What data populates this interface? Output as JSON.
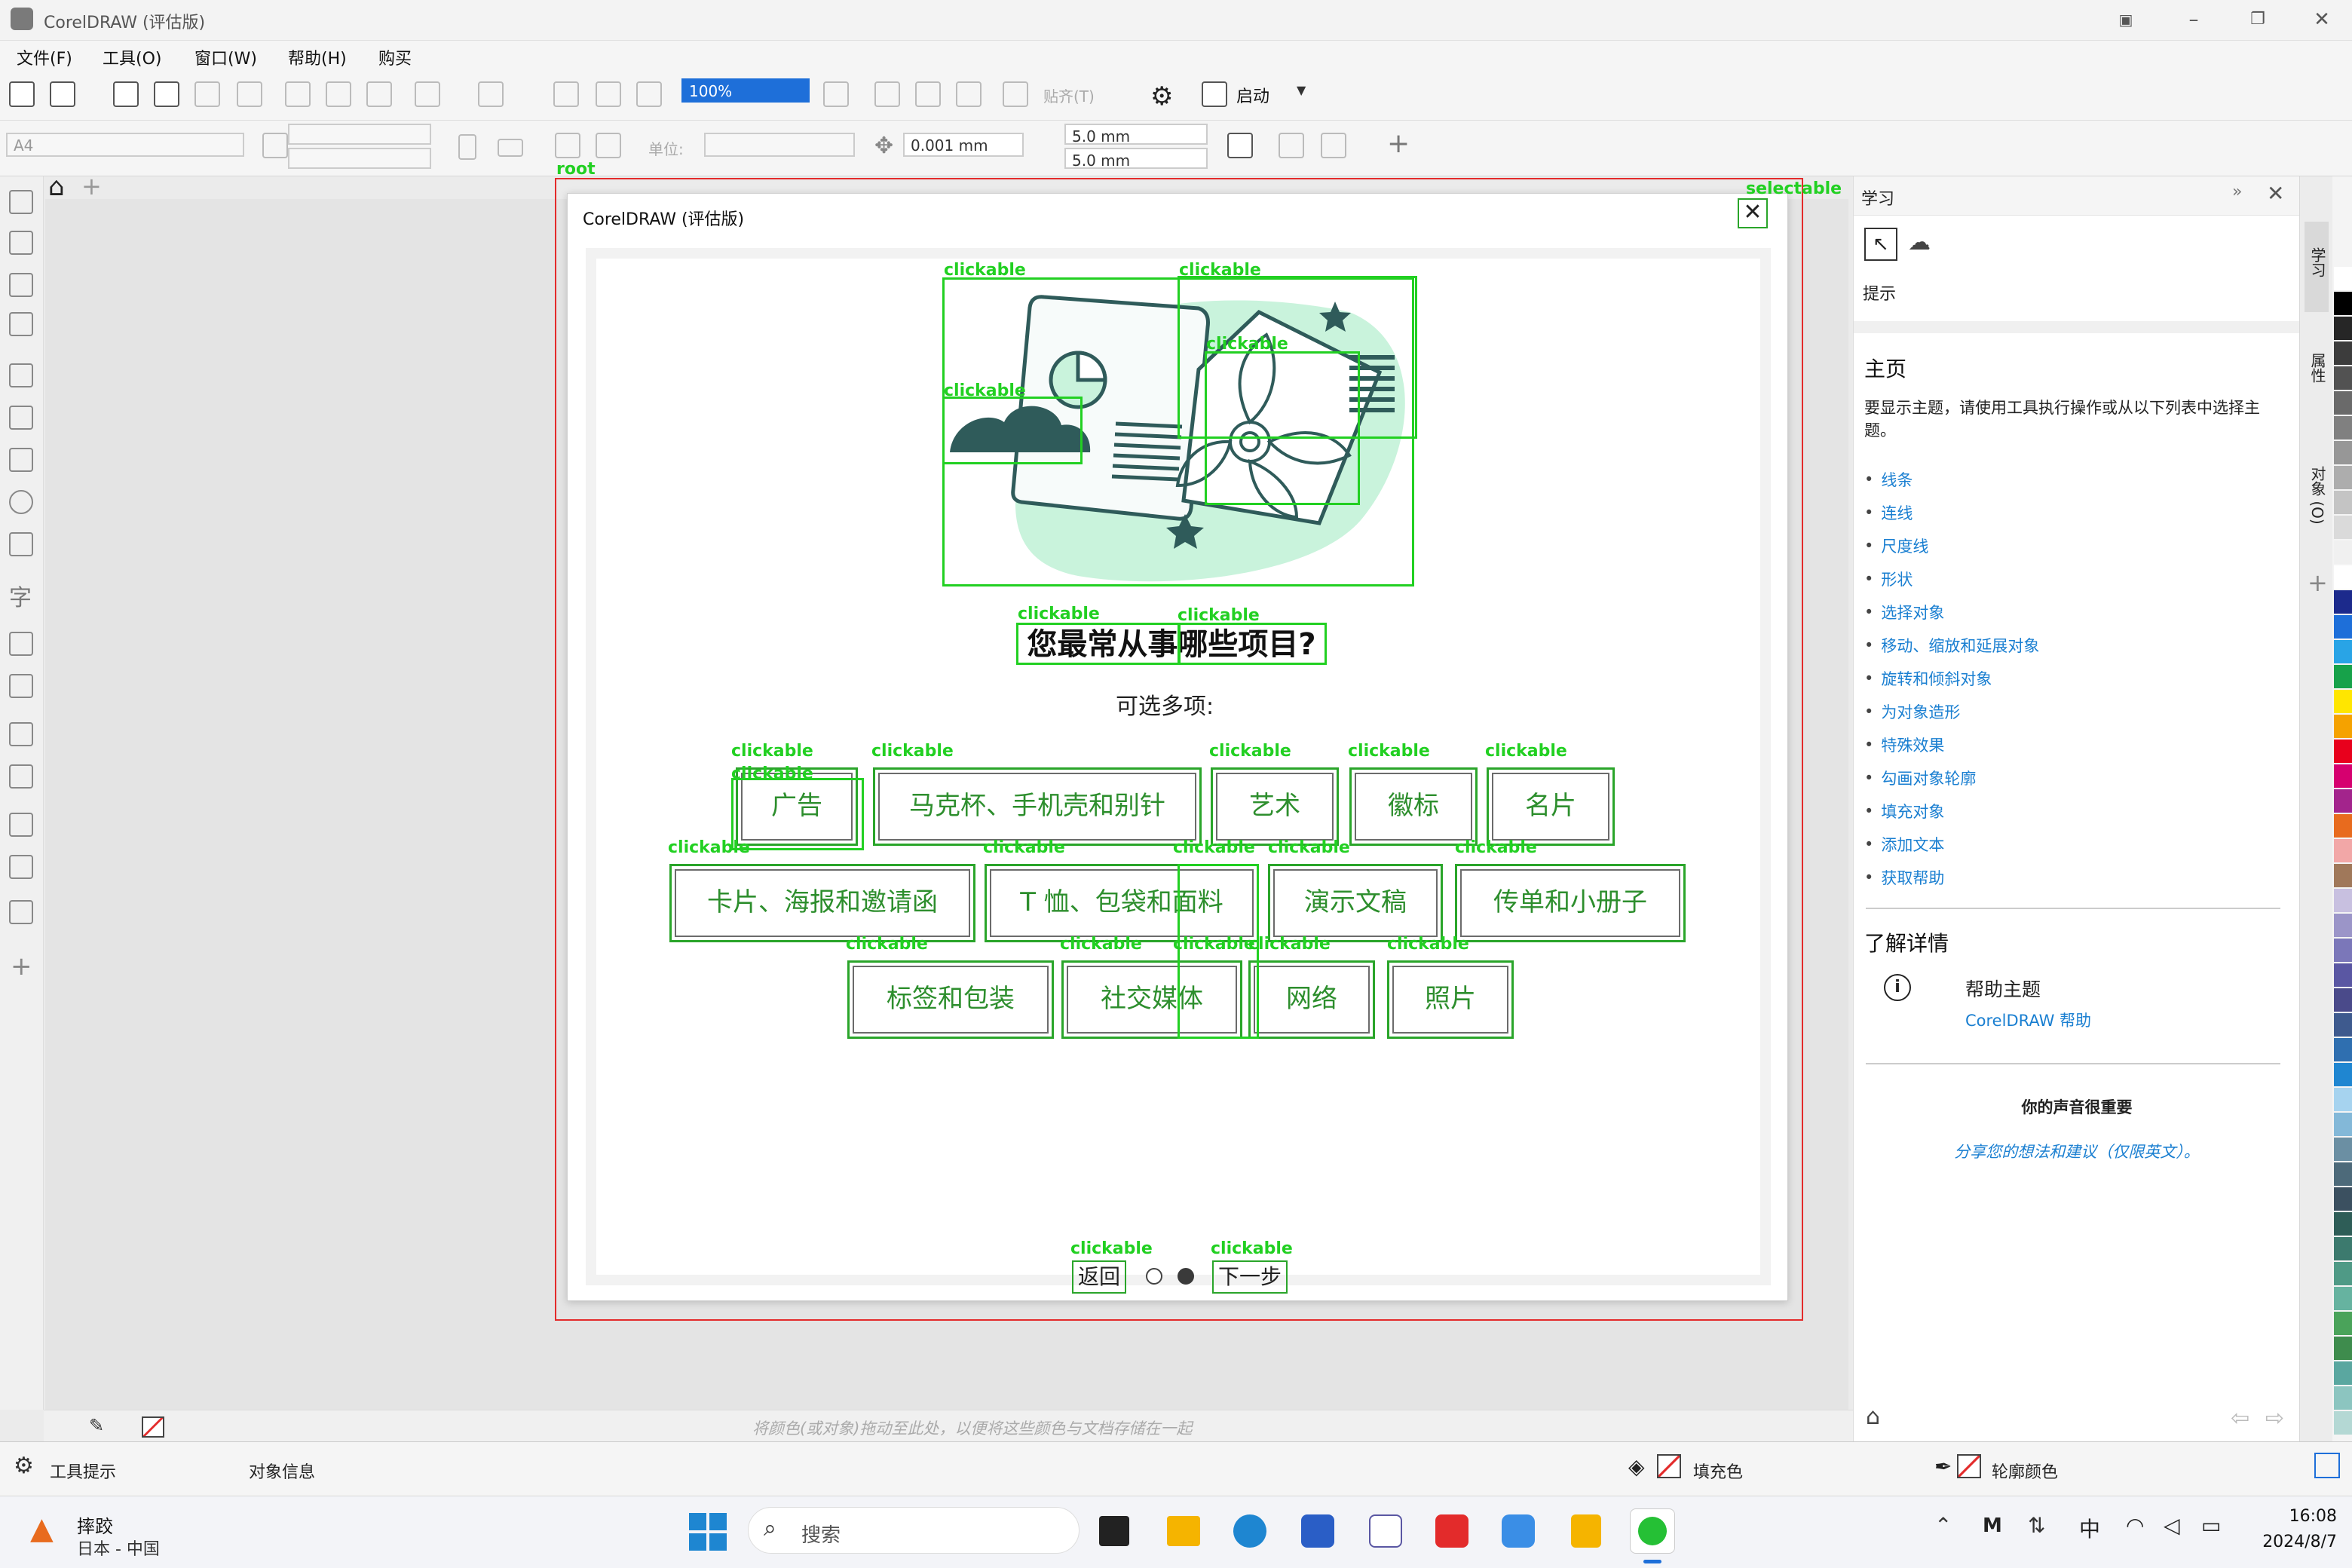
{
  "window": {
    "title": "CorelDRAW (评估版)"
  },
  "menu": [
    "文件(F)",
    "工具(O)",
    "窗口(W)",
    "帮助(H)",
    "购买"
  ],
  "toolbar": {
    "zoom_value": "100%",
    "snap_label": "贴齐(T)",
    "launch_label": "启动"
  },
  "propbar": {
    "page_size": "A4",
    "units_label": "单位:",
    "nudge": "0.001 mm",
    "dup_x": "5.0 mm",
    "dup_y": "5.0 mm"
  },
  "dialog": {
    "title": "CorelDRAW (评估版)",
    "close_glyph": "✕",
    "question": "您最常从事哪些项目?",
    "multi_hint": "可选多项:",
    "options_row1": [
      "广告",
      "马克杯、手机壳和别针",
      "艺术",
      "徽标",
      "名片"
    ],
    "options_row2": [
      "卡片、海报和邀请函",
      "T 恤、包袋和面料",
      "演示文稿",
      "传单和小册子"
    ],
    "options_row3": [
      "标签和包装",
      "社交媒体",
      "网络",
      "照片"
    ],
    "back_label": "返回",
    "next_label": "下一步",
    "page_indicator": {
      "total": 2,
      "current": 2
    }
  },
  "annotations": {
    "root_label": "root",
    "selectable_label": "selectable",
    "clickable_label": "clickable"
  },
  "learn_panel": {
    "header": "学习",
    "hints_label": "提示",
    "home_title": "主页",
    "home_desc": "要显示主题，请使用工具执行操作或从以下列表中选择主题。",
    "topics": [
      "线条",
      "连线",
      "尺度线",
      "形状",
      "选择对象",
      "移动、缩放和延展对象",
      "旋转和倾斜对象",
      "为对象造形",
      "特殊效果",
      "勾画对象轮廓",
      "填充对象",
      "添加文本",
      "获取帮助"
    ],
    "more_title": "了解详情",
    "help_title": "帮助主题",
    "help_link": "CorelDRAW 帮助",
    "voice_title": "你的声音很重要",
    "voice_link": "分享您的想法和建议（仅限英文）。"
  },
  "dock_tabs": [
    "学习",
    "属性",
    "对象 (O)"
  ],
  "palette_hint": "将颜色(或对象)拖动至此处，以便将这些颜色与文档存储在一起",
  "status": {
    "tool_hint": "工具提示",
    "object_info": "对象信息",
    "fill_label": "填充色",
    "outline_label": "轮廓颜色"
  },
  "taskbar": {
    "weather_title": "摔跤",
    "weather_sub": "日本 - 中国",
    "search_placeholder": "搜索",
    "ime": "中",
    "time": "16:08",
    "date": "2024/8/7"
  },
  "colors": {
    "accent_green": "#2d8e2d",
    "annotation_green": "#22d022",
    "annotation_red": "#e32b2b",
    "link_blue": "#1a7fd1",
    "illustration_teal": "#2f5b5a",
    "illustration_mint": "#c9f3dc"
  },
  "swatch_colors": [
    "#ffffff",
    "#000000",
    "#262626",
    "#3c3c3c",
    "#525252",
    "#6a6a6a",
    "#808080",
    "#979797",
    "#adadad",
    "#c4c4c4",
    "#dadada",
    "#f0f0f0",
    "#ffffff",
    "#1c2a8c",
    "#1e6fd9",
    "#29a4e6",
    "#17a24a",
    "#ffe600",
    "#f5a200",
    "#e8001c",
    "#d6006f",
    "#a3248c",
    "#e86b1e",
    "#f2a7a7",
    "#a0785a",
    "#c8c0e0",
    "#9b95c8",
    "#7b77b9",
    "#5a57a3",
    "#4a4a8a",
    "#3e5a8e",
    "#2f6fb0",
    "#1f86d1",
    "#a6d3ef",
    "#83b8d8",
    "#6b8fa3",
    "#4d6a7a",
    "#3b5060",
    "#2e5d57",
    "#3c7a6e",
    "#4f9a86",
    "#66b3a0",
    "#4aa35a",
    "#3e8c4d",
    "#5aa7a0",
    "#8cc5c0",
    "#b4d8d4"
  ]
}
